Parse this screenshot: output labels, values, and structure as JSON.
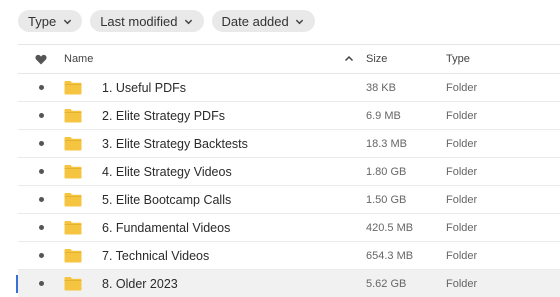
{
  "filters": [
    {
      "label": "Type"
    },
    {
      "label": "Last modified"
    },
    {
      "label": "Date added"
    }
  ],
  "table": {
    "headers": {
      "name": "Name",
      "size": "Size",
      "type": "Type"
    },
    "rows": [
      {
        "name": "1. Useful PDFs",
        "size": "38 KB",
        "type": "Folder"
      },
      {
        "name": "2. Elite Strategy PDFs",
        "size": "6.9 MB",
        "type": "Folder"
      },
      {
        "name": "3. Elite Strategy Backtests",
        "size": "18.3 MB",
        "type": "Folder"
      },
      {
        "name": "4. Elite Strategy Videos",
        "size": "1.80 GB",
        "type": "Folder"
      },
      {
        "name": "5. Elite Bootcamp Calls",
        "size": "1.50 GB",
        "type": "Folder"
      },
      {
        "name": "6. Fundamental Videos",
        "size": "420.5 MB",
        "type": "Folder"
      },
      {
        "name": "7. Technical Videos",
        "size": "654.3 MB",
        "type": "Folder"
      },
      {
        "name": "8. Older 2023",
        "size": "5.62 GB",
        "type": "Folder"
      }
    ]
  },
  "colors": {
    "folder": "#f5c542",
    "accent": "#3b6fd8",
    "chip_bg": "#e9e9ea"
  },
  "icons": {
    "favorite_header": "heart-icon",
    "row_folder": "folder-icon",
    "sort": "chevron-up-icon",
    "filter_dropdown": "chevron-down-icon"
  }
}
